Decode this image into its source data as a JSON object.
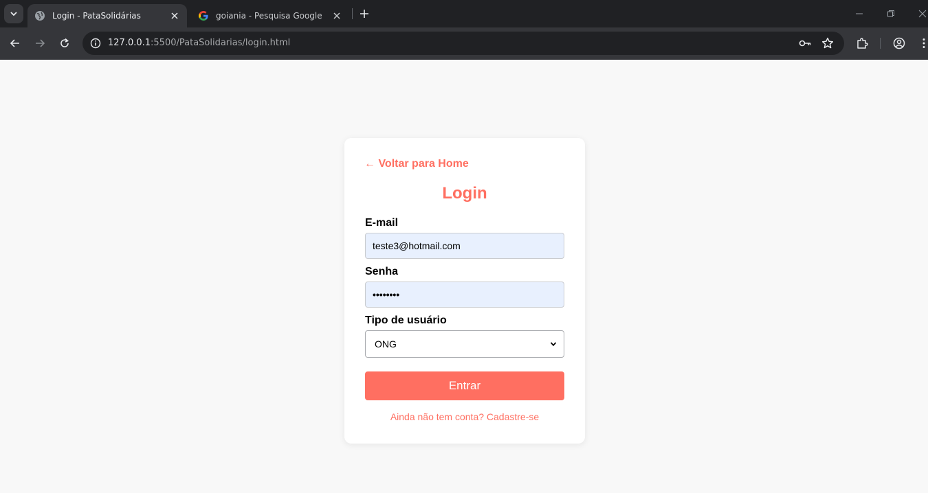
{
  "browser": {
    "tabs": [
      {
        "title": "Login - PataSolidárias",
        "favicon": "globe-icon",
        "active": true
      },
      {
        "title": "goiania - Pesquisa Google",
        "favicon": "google-icon",
        "active": false
      }
    ],
    "url_host": "127.0.0.1",
    "url_rest": ":5500/PataSolidarias/login.html"
  },
  "login": {
    "back_link": "← Voltar para Home",
    "title": "Login",
    "email_label": "E-mail",
    "email_value": "teste3@hotmail.com",
    "password_label": "Senha",
    "password_value": "••••••••",
    "user_type_label": "Tipo de usuário",
    "user_type_value": "ONG",
    "submit_label": "Entrar",
    "register_text": "Ainda não tem conta? Cadastre-se"
  },
  "colors": {
    "accent": "#ff6f61",
    "input_autofill_bg": "#e8f0fe",
    "page_bg": "#f8f8f8"
  }
}
